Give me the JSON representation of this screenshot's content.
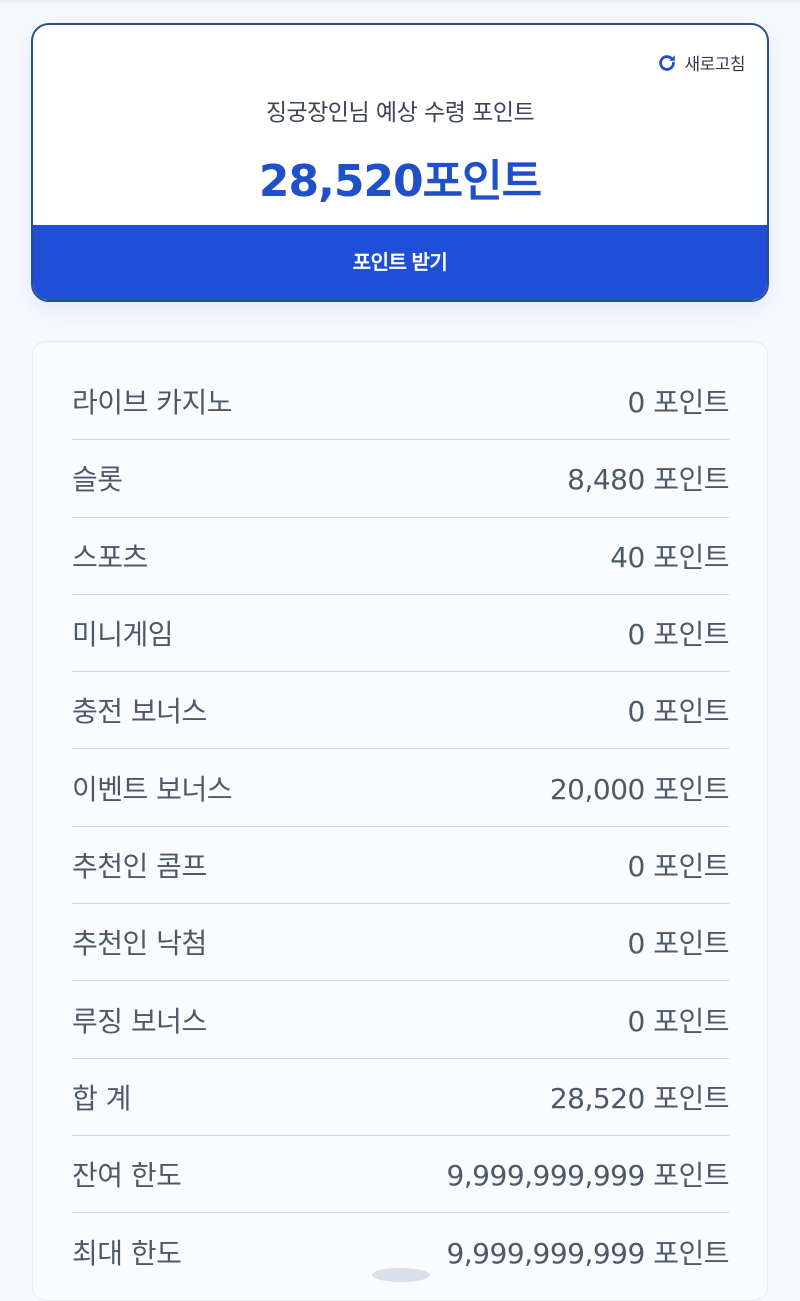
{
  "summary": {
    "refresh_label": "새로고침",
    "expected_label": "징궁장인님 예상 수령 포인트",
    "expected_amount": "28,520포인트",
    "receive_button": "포인트 받기"
  },
  "details": [
    {
      "label": "라이브 카지노",
      "value": "0 포인트"
    },
    {
      "label": "슬롯",
      "value": "8,480 포인트"
    },
    {
      "label": "스포츠",
      "value": "40 포인트"
    },
    {
      "label": "미니게임",
      "value": "0 포인트"
    },
    {
      "label": "충전 보너스",
      "value": "0 포인트"
    },
    {
      "label": "이벤트 보너스",
      "value": "20,000 포인트"
    },
    {
      "label": "추천인 콤프",
      "value": "0 포인트"
    },
    {
      "label": "추천인 낙첨",
      "value": "0 포인트"
    },
    {
      "label": "루징 보너스",
      "value": "0 포인트"
    },
    {
      "label": "합 계",
      "value": "28,520 포인트"
    },
    {
      "label": "잔여 한도",
      "value": "9,999,999,999 포인트"
    },
    {
      "label": "최대 한도",
      "value": "9,999,999,999 포인트"
    }
  ],
  "colors": {
    "accent": "#1f4fd6",
    "amount": "#1f4fc9",
    "card_border": "#2c4f86"
  },
  "icons": {
    "refresh": "refresh-icon"
  }
}
